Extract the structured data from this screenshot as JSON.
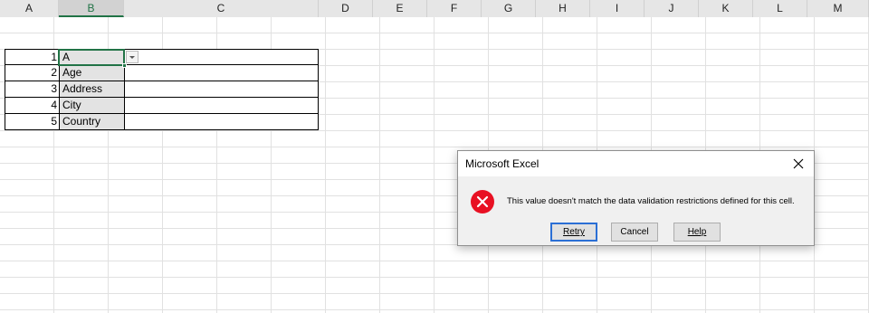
{
  "columns": [
    "A",
    "B",
    "C",
    "D",
    "E",
    "F",
    "G",
    "H",
    "I",
    "J",
    "K",
    "L",
    "M"
  ],
  "table": {
    "rows": [
      {
        "num": "1",
        "label": "A"
      },
      {
        "num": "2",
        "label": "Age"
      },
      {
        "num": "3",
        "label": "Address"
      },
      {
        "num": "4",
        "label": "City"
      },
      {
        "num": "5",
        "label": "Country"
      }
    ]
  },
  "dialog": {
    "title": "Microsoft Excel",
    "message": "This value doesn't match the data validation restrictions defined for this cell.",
    "buttons": {
      "retry": "Retry",
      "cancel": "Cancel",
      "help": "Help"
    },
    "icons": {
      "error": "error-icon",
      "close": "close-icon"
    }
  },
  "colors": {
    "accent": "#217346",
    "error": "#e81123"
  }
}
